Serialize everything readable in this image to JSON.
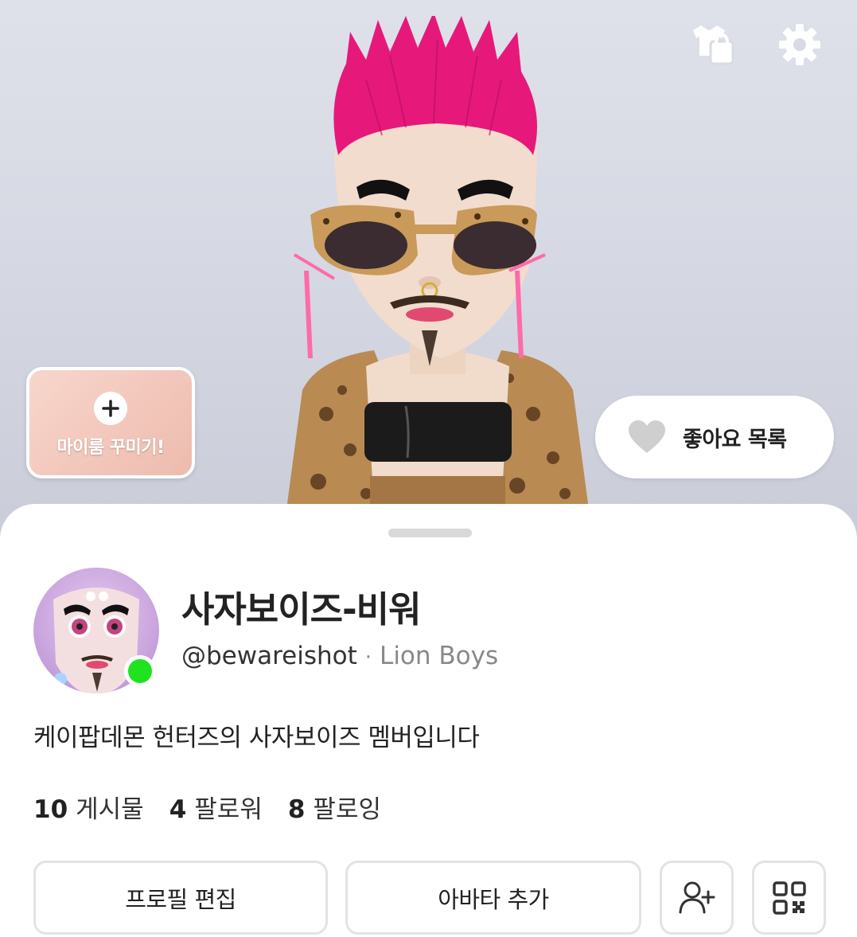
{
  "header": {
    "myroom_label": "마이룸 꾸미기!",
    "likes_label": "좋아요 목록",
    "icons": [
      "closet-icon",
      "settings-icon",
      "plus-icon",
      "heart-icon"
    ]
  },
  "profile": {
    "display_name": "사자보이즈-비워",
    "username": "@bewareishot",
    "separator": "·",
    "crew": "Lion Boys",
    "bio": "케이팝데몬 헌터즈의 사자보이즈 멤버입니다",
    "online": true,
    "online_color": "#1ee31e"
  },
  "stats": [
    {
      "value": "10",
      "label": "게시물"
    },
    {
      "value": "4",
      "label": "팔로워"
    },
    {
      "value": "8",
      "label": "팔로잉"
    }
  ],
  "actions": {
    "edit_profile": "프로필 편집",
    "add_avatar": "아바타 추가",
    "icons": [
      "add-friend-icon",
      "qr-code-icon"
    ]
  },
  "colors": {
    "hair": "#e6197a",
    "background": "#d9dbe4",
    "myroom_card": "#f3c7bb"
  }
}
